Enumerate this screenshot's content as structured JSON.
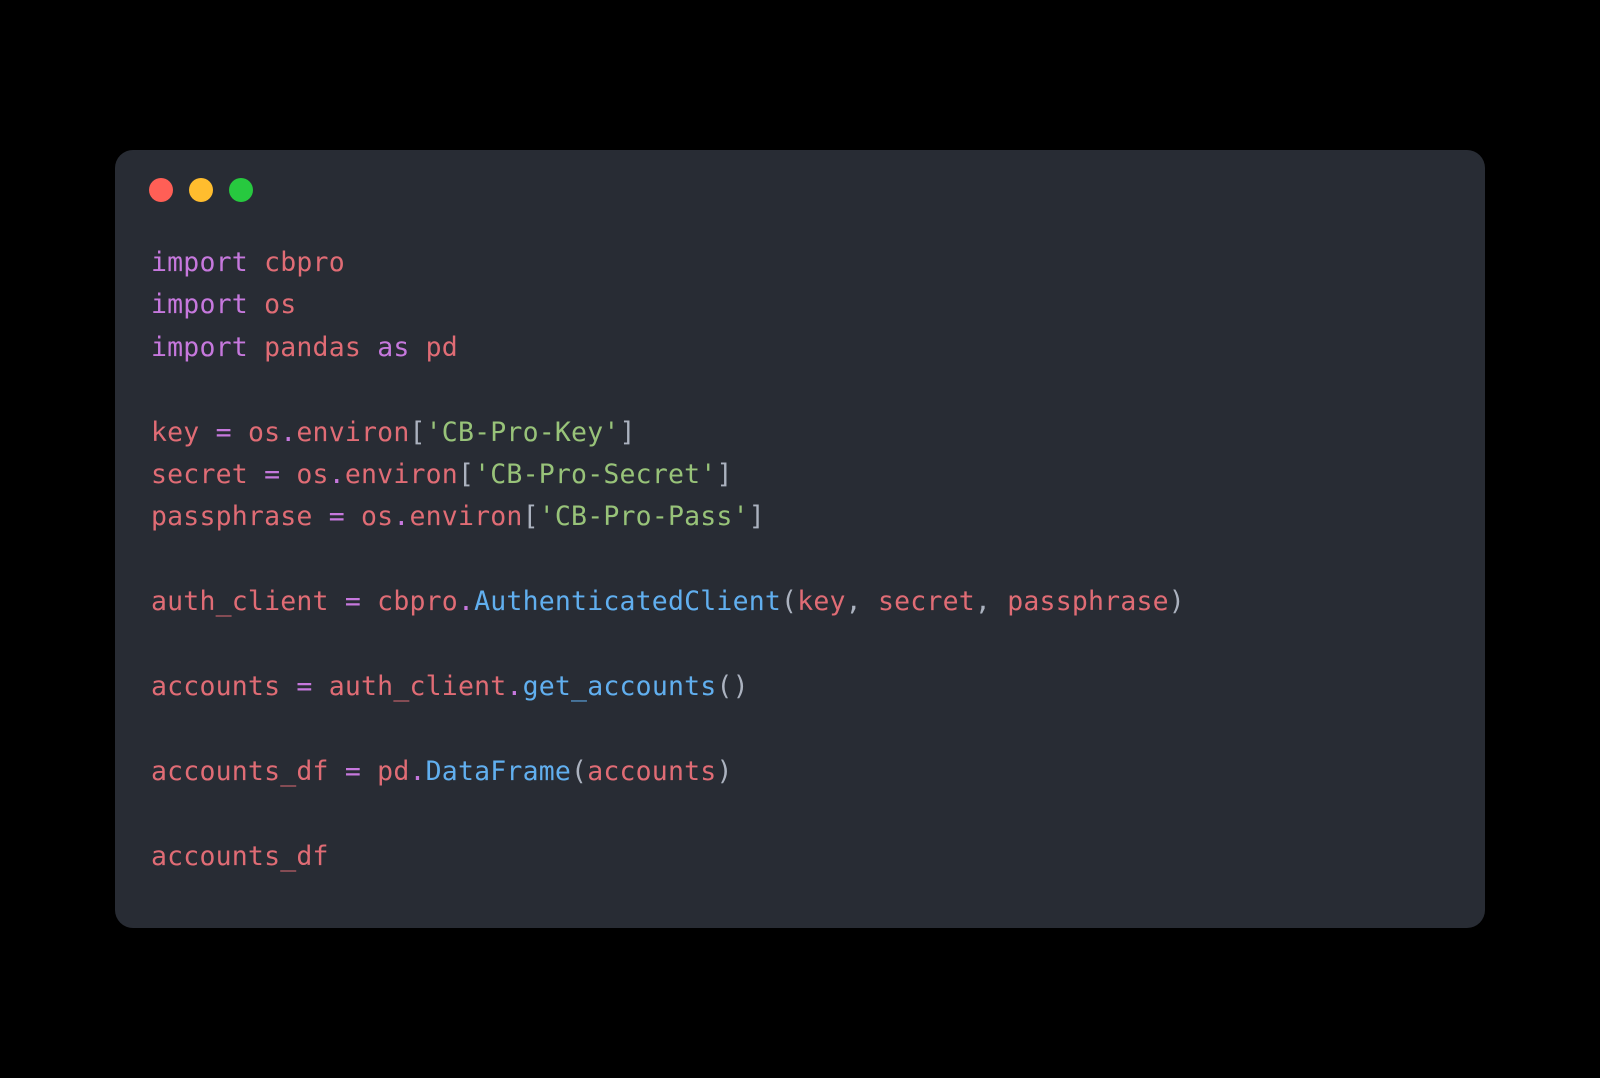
{
  "window": {
    "traffic_lights": {
      "red": "#ff5f56",
      "yellow": "#ffbd2e",
      "green": "#27c93f"
    }
  },
  "code": {
    "lines": [
      [
        {
          "t": "import",
          "c": "kw"
        },
        {
          "t": " ",
          "c": "pun"
        },
        {
          "t": "cbpro",
          "c": "var"
        }
      ],
      [
        {
          "t": "import",
          "c": "kw"
        },
        {
          "t": " ",
          "c": "pun"
        },
        {
          "t": "os",
          "c": "var"
        }
      ],
      [
        {
          "t": "import",
          "c": "kw"
        },
        {
          "t": " ",
          "c": "pun"
        },
        {
          "t": "pandas",
          "c": "var"
        },
        {
          "t": " ",
          "c": "pun"
        },
        {
          "t": "as",
          "c": "kw"
        },
        {
          "t": " ",
          "c": "pun"
        },
        {
          "t": "pd",
          "c": "var"
        }
      ],
      [],
      [
        {
          "t": "key",
          "c": "var"
        },
        {
          "t": " ",
          "c": "pun"
        },
        {
          "t": "=",
          "c": "kw"
        },
        {
          "t": " ",
          "c": "pun"
        },
        {
          "t": "os",
          "c": "var"
        },
        {
          "t": ".",
          "c": "kw"
        },
        {
          "t": "environ",
          "c": "var"
        },
        {
          "t": "[",
          "c": "pun"
        },
        {
          "t": "'CB-Pro-Key'",
          "c": "str"
        },
        {
          "t": "]",
          "c": "pun"
        }
      ],
      [
        {
          "t": "secret",
          "c": "var"
        },
        {
          "t": " ",
          "c": "pun"
        },
        {
          "t": "=",
          "c": "kw"
        },
        {
          "t": " ",
          "c": "pun"
        },
        {
          "t": "os",
          "c": "var"
        },
        {
          "t": ".",
          "c": "kw"
        },
        {
          "t": "environ",
          "c": "var"
        },
        {
          "t": "[",
          "c": "pun"
        },
        {
          "t": "'CB-Pro-Secret'",
          "c": "str"
        },
        {
          "t": "]",
          "c": "pun"
        }
      ],
      [
        {
          "t": "passphrase",
          "c": "var"
        },
        {
          "t": " ",
          "c": "pun"
        },
        {
          "t": "=",
          "c": "kw"
        },
        {
          "t": " ",
          "c": "pun"
        },
        {
          "t": "os",
          "c": "var"
        },
        {
          "t": ".",
          "c": "kw"
        },
        {
          "t": "environ",
          "c": "var"
        },
        {
          "t": "[",
          "c": "pun"
        },
        {
          "t": "'CB-Pro-Pass'",
          "c": "str"
        },
        {
          "t": "]",
          "c": "pun"
        }
      ],
      [],
      [
        {
          "t": "auth_client",
          "c": "var"
        },
        {
          "t": " ",
          "c": "pun"
        },
        {
          "t": "=",
          "c": "kw"
        },
        {
          "t": " ",
          "c": "pun"
        },
        {
          "t": "cbpro",
          "c": "var"
        },
        {
          "t": ".",
          "c": "kw"
        },
        {
          "t": "AuthenticatedClient",
          "c": "fn"
        },
        {
          "t": "(",
          "c": "pun"
        },
        {
          "t": "key",
          "c": "var"
        },
        {
          "t": ", ",
          "c": "pun"
        },
        {
          "t": "secret",
          "c": "var"
        },
        {
          "t": ", ",
          "c": "pun"
        },
        {
          "t": "passphrase",
          "c": "var"
        },
        {
          "t": ")",
          "c": "pun"
        }
      ],
      [],
      [
        {
          "t": "accounts",
          "c": "var"
        },
        {
          "t": " ",
          "c": "pun"
        },
        {
          "t": "=",
          "c": "kw"
        },
        {
          "t": " ",
          "c": "pun"
        },
        {
          "t": "auth_client",
          "c": "var"
        },
        {
          "t": ".",
          "c": "kw"
        },
        {
          "t": "get_accounts",
          "c": "fn"
        },
        {
          "t": "()",
          "c": "pun"
        }
      ],
      [],
      [
        {
          "t": "accounts_df",
          "c": "var"
        },
        {
          "t": " ",
          "c": "pun"
        },
        {
          "t": "=",
          "c": "kw"
        },
        {
          "t": " ",
          "c": "pun"
        },
        {
          "t": "pd",
          "c": "var"
        },
        {
          "t": ".",
          "c": "kw"
        },
        {
          "t": "DataFrame",
          "c": "fn"
        },
        {
          "t": "(",
          "c": "pun"
        },
        {
          "t": "accounts",
          "c": "var"
        },
        {
          "t": ")",
          "c": "pun"
        }
      ],
      [],
      [
        {
          "t": "accounts_df",
          "c": "var"
        }
      ]
    ]
  }
}
